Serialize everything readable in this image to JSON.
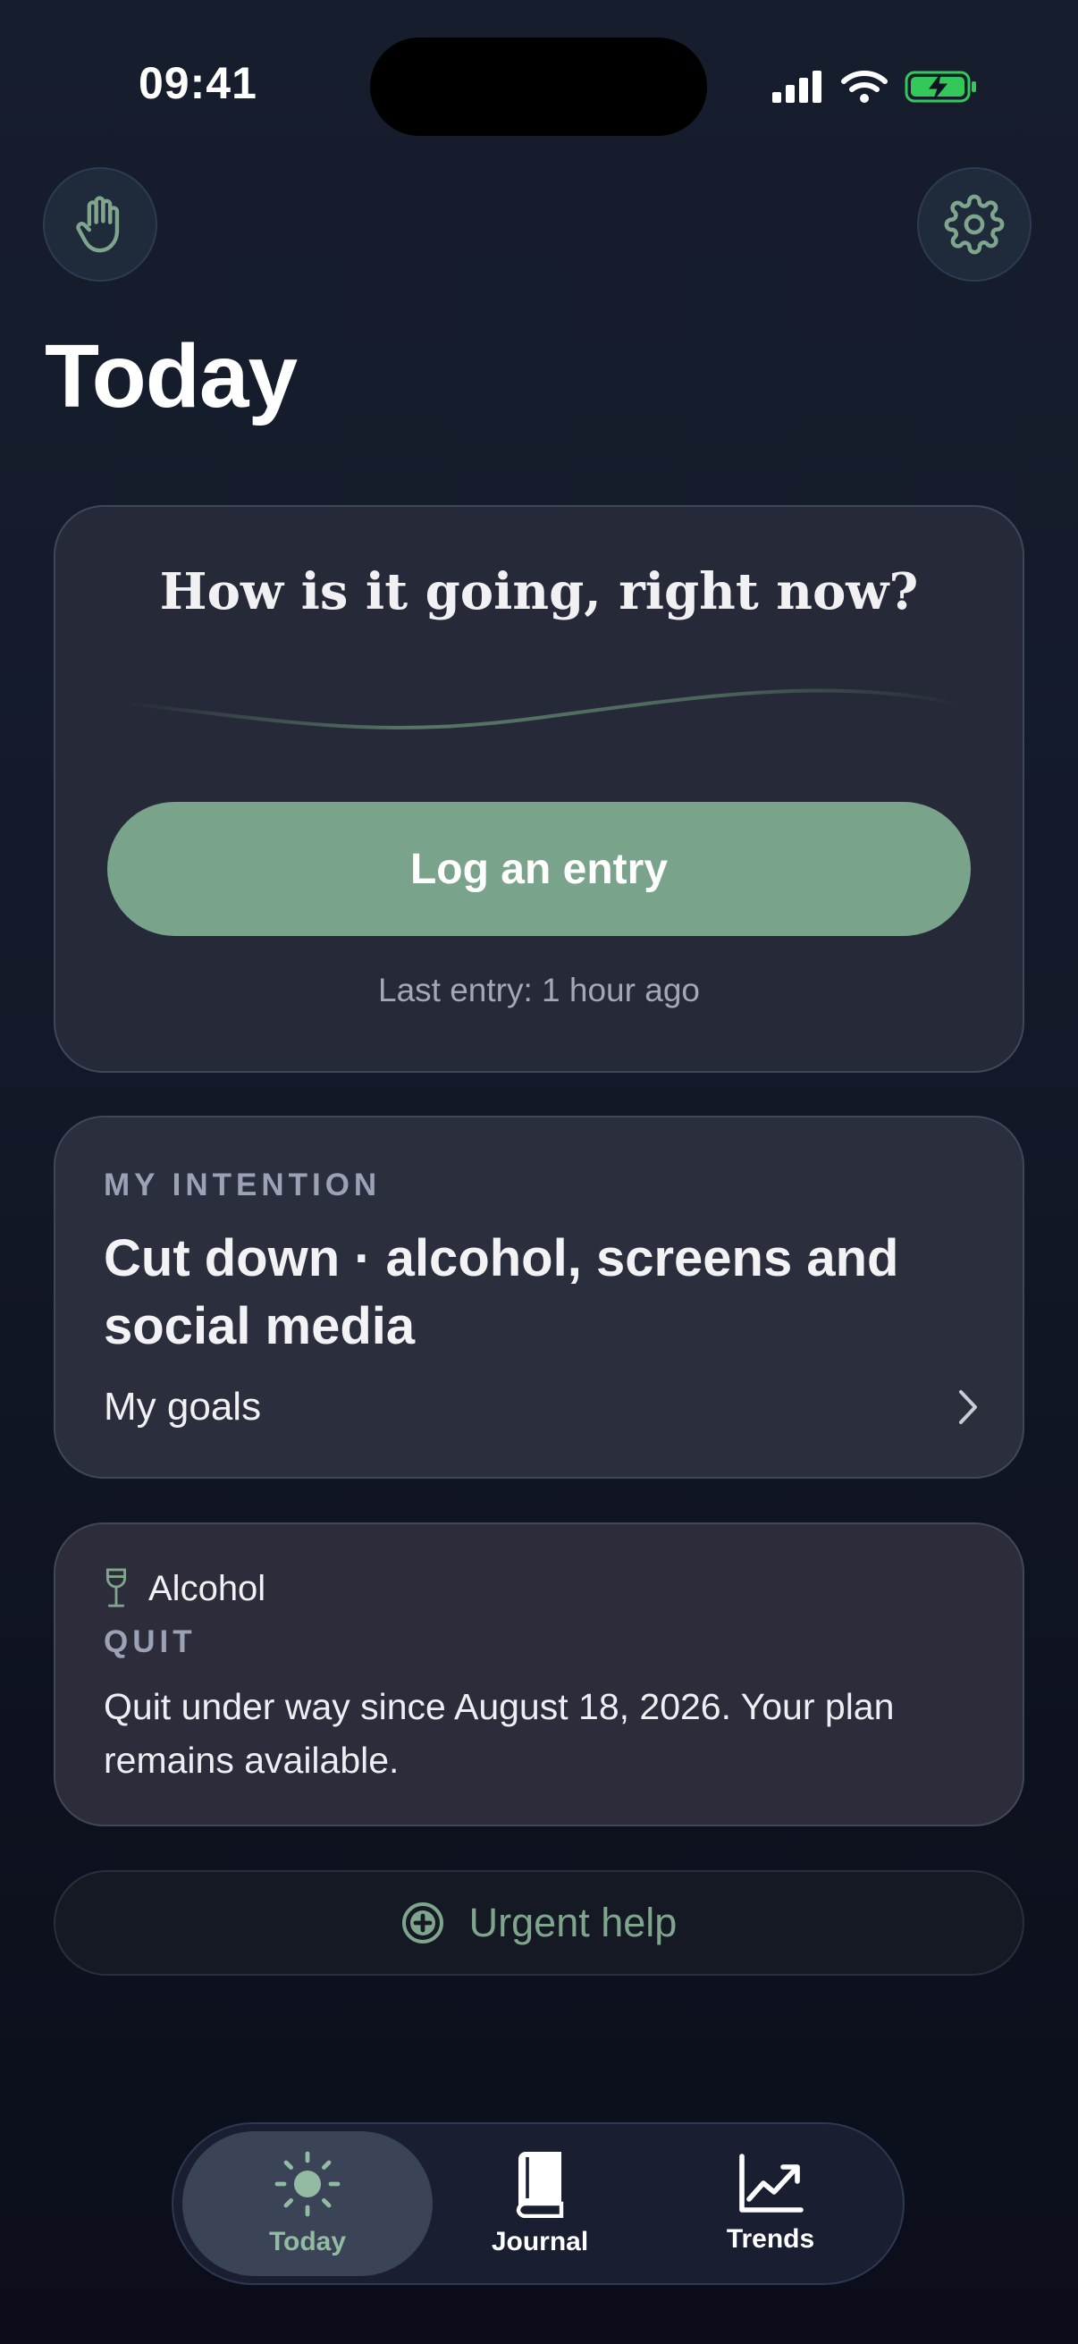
{
  "status_bar": {
    "time": "09:41",
    "icons": [
      "cellular-signal-icon",
      "wifi-icon",
      "battery-charging-icon"
    ]
  },
  "header": {
    "left_icon": "hand-icon",
    "right_icon": "gear-icon",
    "title": "Today"
  },
  "checkin": {
    "question": "How is it going, right now?",
    "button_label": "Log an entry",
    "last_entry": "Last entry: 1 hour ago"
  },
  "intention": {
    "label": "MY INTENTION",
    "text": "Cut down · alcohol, screens and social media",
    "link_label": "My goals"
  },
  "substance": {
    "icon": "wine-glass-icon",
    "name": "Alcohol",
    "status": "QUIT",
    "description": "Quit under way since August 18, 2026. Your plan remains available."
  },
  "urgent": {
    "icon": "plus-circle-icon",
    "label": "Urgent help"
  },
  "tabs": [
    {
      "label": "Today",
      "icon": "sun-icon",
      "active": true
    },
    {
      "label": "Journal",
      "icon": "book-icon",
      "active": false
    },
    {
      "label": "Trends",
      "icon": "trend-chart-icon",
      "active": false
    }
  ],
  "colors": {
    "accent": "#79a38b",
    "background": "#141a29",
    "card": "#262a38",
    "battery": "#34c759"
  }
}
